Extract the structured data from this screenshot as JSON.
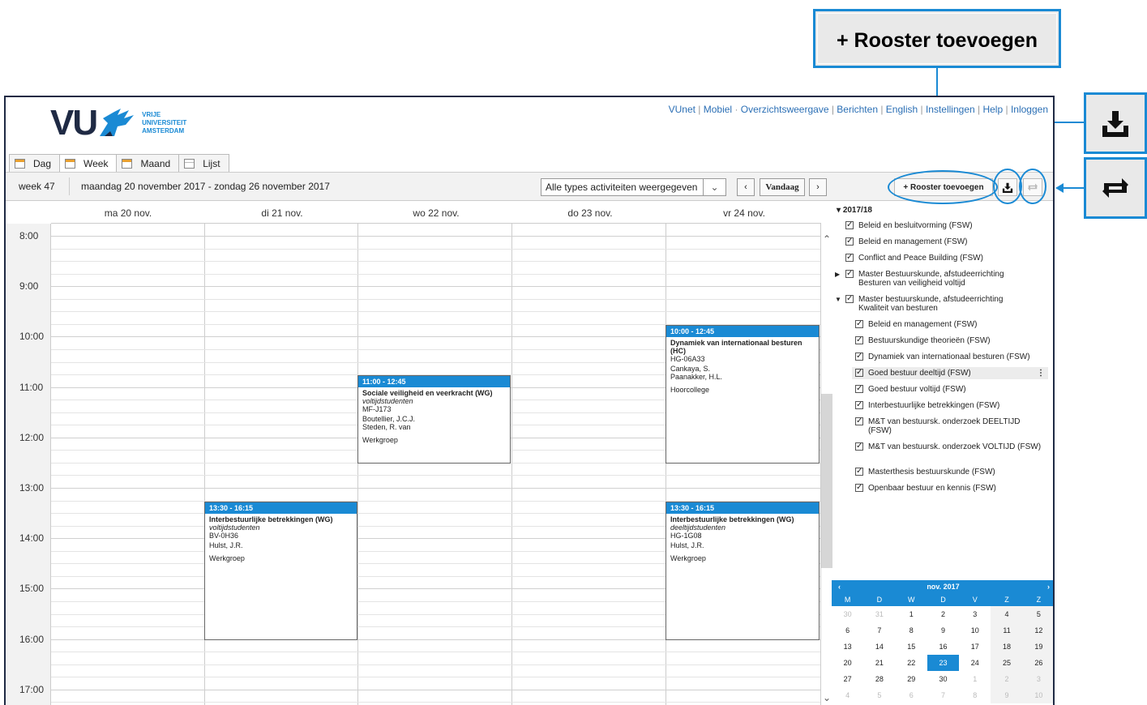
{
  "callouts": {
    "add_schedule": "+ Rooster toevoegen"
  },
  "header": {
    "logo_main": "VU",
    "logo_lines": [
      "VRIJE",
      "UNIVERSITEIT",
      "AMSTERDAM"
    ],
    "links": [
      "VUnet",
      "Mobiel",
      "Overzichtsweergave",
      "Berichten",
      "English",
      "Instellingen",
      "Help",
      "Inloggen"
    ]
  },
  "tabs": [
    {
      "label": "Dag",
      "icon": "calendar-icon"
    },
    {
      "label": "Week",
      "icon": "calendar-icon",
      "active": true
    },
    {
      "label": "Maand",
      "icon": "calendar-icon"
    },
    {
      "label": "Lijst",
      "icon": "list-icon"
    }
  ],
  "toolbar": {
    "week": "week 47",
    "range": "maandag 20 november 2017 - zondag 26 november 2017",
    "filter": "Alle types activiteiten weergegeven",
    "today": "Vandaag",
    "add_schedule": "+ Rooster toevoegen"
  },
  "days": [
    "ma 20 nov.",
    "di 21 nov.",
    "wo 22 nov.",
    "do 23 nov.",
    "vr 24 nov."
  ],
  "times": [
    "8:00",
    "9:00",
    "10:00",
    "11:00",
    "12:00",
    "13:00",
    "14:00",
    "15:00",
    "16:00",
    "17:00"
  ],
  "events": [
    {
      "time": "11:00 - 12:45",
      "title": "Sociale veiligheid en veerkracht (WG)",
      "audience": "voltijdstudenten",
      "room": "MF-J173",
      "staff": [
        "Boutellier, J.C.J.",
        "Steden, R. van"
      ],
      "type": "Werkgroep"
    },
    {
      "time": "10:00 - 12:45",
      "title": "Dynamiek van internationaal besturen (HC)",
      "audience": "",
      "room": "HG-06A33",
      "staff": [
        "Cankaya, S.",
        "Paanakker, H.L."
      ],
      "type": "Hoorcollege"
    },
    {
      "time": "13:30 - 16:15",
      "title": "Interbestuurlijke betrekkingen (WG)",
      "audience": "voltijdstudenten",
      "room": "BV-0H36",
      "staff": [
        "Hulst, J.R."
      ],
      "type": "Werkgroep"
    },
    {
      "time": "13:30 - 16:15",
      "title": "Interbestuurlijke betrekkingen (WG)",
      "audience": "deeltijdstudenten",
      "room": "HG-1G08",
      "staff": [
        "Hulst, J.R."
      ],
      "type": "Werkgroep"
    }
  ],
  "sidebar": {
    "year": "2017/18",
    "items": [
      "Beleid en besluitvorming (FSW)",
      "Beleid en management (FSW)",
      "Conflict and Peace Building (FSW)",
      "Master Bestuurskunde, afstudeerrichting Besturen van veiligheid voltijd",
      "Master bestuurskunde, afstudeerrichting Kwaliteit van besturen",
      "Beleid en management (FSW)",
      "Bestuurskundige theorieën (FSW)",
      "Dynamiek van internationaal besturen (FSW)",
      "Goed bestuur deeltijd (FSW)",
      "Goed bestuur voltijd (FSW)",
      "Interbestuurlijke betrekkingen (FSW)",
      "M&T van bestuursk. onderzoek DEELTIJD (FSW)",
      "M&T van bestuursk. onderzoek VOLTIJD (FSW)",
      "Masterthesis bestuurskunde (FSW)",
      "Openbaar bestuur en kennis (FSW)"
    ]
  },
  "minical": {
    "month": "nov. 2017",
    "weekdays": [
      "M",
      "D",
      "W",
      "D",
      "V",
      "Z",
      "Z"
    ],
    "weeks": [
      [
        "30",
        "31",
        "1",
        "2",
        "3",
        "4",
        "5"
      ],
      [
        "6",
        "7",
        "8",
        "9",
        "10",
        "11",
        "12"
      ],
      [
        "13",
        "14",
        "15",
        "16",
        "17",
        "18",
        "19"
      ],
      [
        "20",
        "21",
        "22",
        "23",
        "24",
        "25",
        "26"
      ],
      [
        "27",
        "28",
        "29",
        "30",
        "1",
        "2",
        "3"
      ],
      [
        "4",
        "5",
        "6",
        "7",
        "8",
        "9",
        "10"
      ]
    ],
    "today": "23"
  },
  "colors": {
    "accent": "#1a8ad4",
    "navy": "#1f2a44"
  }
}
